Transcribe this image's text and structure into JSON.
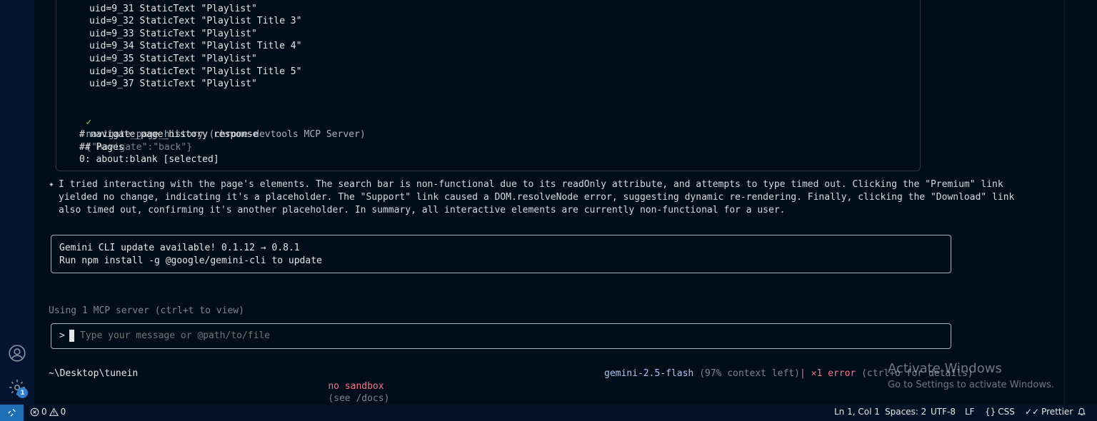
{
  "tool_output": {
    "uid_lines": [
      "uid=9_31 StaticText \"Playlist\"",
      "uid=9_32 StaticText \"Playlist Title 3\"",
      "uid=9_33 StaticText \"Playlist\"",
      "uid=9_34 StaticText \"Playlist Title 4\"",
      "uid=9_35 StaticText \"Playlist\"",
      "uid=9_36 StaticText \"Playlist Title 5\"",
      "uid=9_37 StaticText \"Playlist\""
    ],
    "check_mark": "✓",
    "tool_call_name": "navigate_page_history (chrome-devtools MCP Server)",
    "tool_call_args": "{\"navigate\":\"back\"}",
    "response_lines": [
      "# navigate_page_history response",
      "## Pages",
      "0: about:blank [selected]"
    ]
  },
  "assistant_message": {
    "icon": "✦",
    "lines": [
      "I tried interacting with the page's elements. The search bar is non-functional due to its readOnly attribute, and attempts to type timed out. Clicking the \"Premium\" link",
      "yielded no change, indicating it's a placeholder. The \"Support\" link caused a DOM.resolveNode error, suggesting dynamic re-rendering. Finally, clicking the \"Download\" link",
      "also timed out, confirming it's another placeholder. In summary, all interactive elements are currently non-functional for a user."
    ]
  },
  "update_notice": {
    "line1": "Gemini CLI update available! 0.1.12 → 0.8.1",
    "line2": "Run npm install -g @google/gemini-cli to update"
  },
  "mcp_status": "Using 1 MCP server (ctrl+t to view)",
  "input": {
    "prompt": ">",
    "placeholder": "Type your message or @path/to/file"
  },
  "footer": {
    "path": "~\\Desktop\\tunein",
    "sandbox": "no sandbox",
    "sandbox_hint": "(see /docs)",
    "model": "gemini-2.5-flash",
    "context": "(97% context left)",
    "separator": "|",
    "error_icon": "✕",
    "error_text": "1 error",
    "error_hint": "(ctrl+o for details)"
  },
  "watermark": {
    "title": "Activate Windows",
    "subtitle": "Go to Settings to activate Windows."
  },
  "activity_bar": {
    "settings_badge": "1"
  },
  "status_bar": {
    "errors": "0",
    "warnings": "0",
    "position": "Ln 1, Col 1",
    "spaces": "Spaces: 2",
    "encoding": "UTF-8",
    "eol": "LF",
    "language": "CSS",
    "formatter": "Prettier"
  }
}
